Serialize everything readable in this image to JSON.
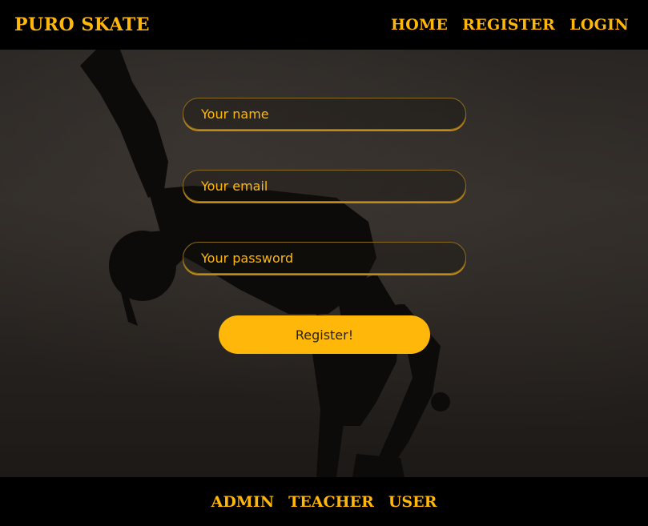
{
  "header": {
    "brand": "PURO SKATE",
    "nav": [
      "HOME",
      "REGISTER",
      "LOGIN"
    ]
  },
  "form": {
    "name_placeholder": "Your name",
    "email_placeholder": "Your email",
    "password_placeholder": "Your password",
    "submit_label": "Register!"
  },
  "footer": {
    "links": [
      "ADMIN",
      "TEACHER",
      "USER"
    ]
  },
  "colors": {
    "accent": "#ffb80a",
    "background": "#000000"
  }
}
